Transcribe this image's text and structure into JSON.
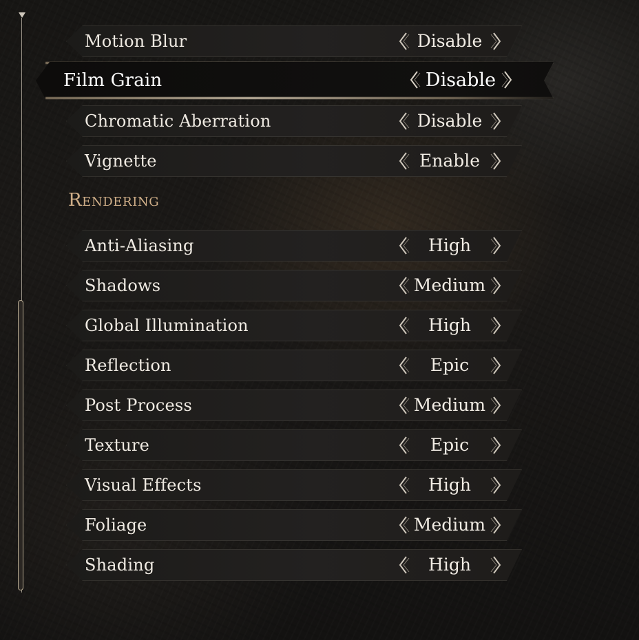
{
  "effects": [
    {
      "label": "Motion Blur",
      "value": "Disable"
    },
    {
      "label": "Film Grain",
      "value": "Disable"
    },
    {
      "label": "Chromatic Aberration",
      "value": "Disable"
    },
    {
      "label": "Vignette",
      "value": "Enable"
    }
  ],
  "rendering": {
    "header": "Rendering",
    "items": [
      {
        "label": "Anti-Aliasing",
        "value": "High"
      },
      {
        "label": "Shadows",
        "value": "Medium"
      },
      {
        "label": "Global Illumination",
        "value": "High"
      },
      {
        "label": "Reflection",
        "value": "Epic"
      },
      {
        "label": "Post Process",
        "value": "Medium"
      },
      {
        "label": "Texture",
        "value": "Epic"
      },
      {
        "label": "Visual Effects",
        "value": "High"
      },
      {
        "label": "Foliage",
        "value": "Medium"
      },
      {
        "label": "Shading",
        "value": "High"
      }
    ]
  },
  "selected_setting": "Film Grain",
  "icons": {
    "decrease": "chevron-left-icon",
    "increase": "chevron-right-icon"
  },
  "colors": {
    "section_header": "#cfae88",
    "text": "#efeae2"
  }
}
